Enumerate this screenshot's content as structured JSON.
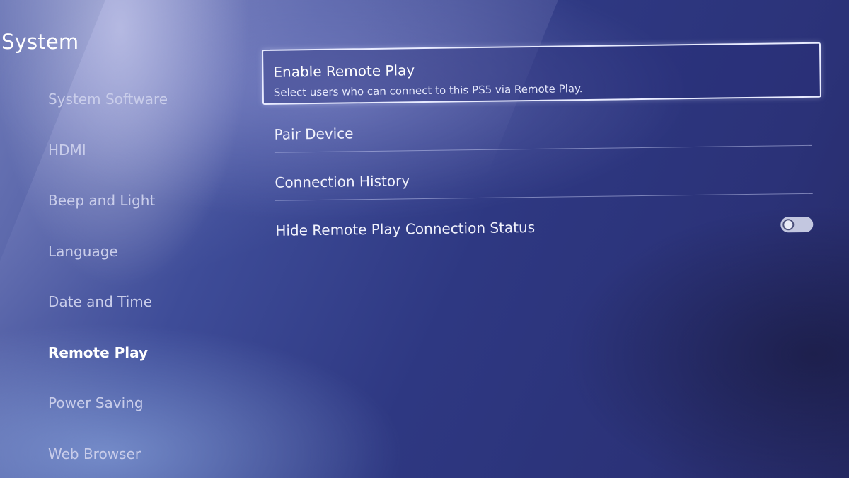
{
  "header": {
    "title": "System"
  },
  "sidebar": {
    "items": [
      {
        "label": "System Software",
        "selected": false
      },
      {
        "label": "HDMI",
        "selected": false
      },
      {
        "label": "Beep and Light",
        "selected": false
      },
      {
        "label": "Language",
        "selected": false
      },
      {
        "label": "Date and Time",
        "selected": false
      },
      {
        "label": "Remote Play",
        "selected": true
      },
      {
        "label": "Power Saving",
        "selected": false
      },
      {
        "label": "Web Browser",
        "selected": false
      }
    ]
  },
  "main": {
    "rows": [
      {
        "label": "Enable Remote Play",
        "description": "Select users who can connect to this PS5 via Remote Play.",
        "focused": true
      },
      {
        "label": "Pair Device"
      },
      {
        "label": "Connection History"
      },
      {
        "label": "Hide Remote Play Connection Status",
        "toggle": "off"
      }
    ]
  },
  "colors": {
    "background": "#2e3882",
    "focus_border": "#e8ebff",
    "toggle_off": "#c3c7e0"
  }
}
